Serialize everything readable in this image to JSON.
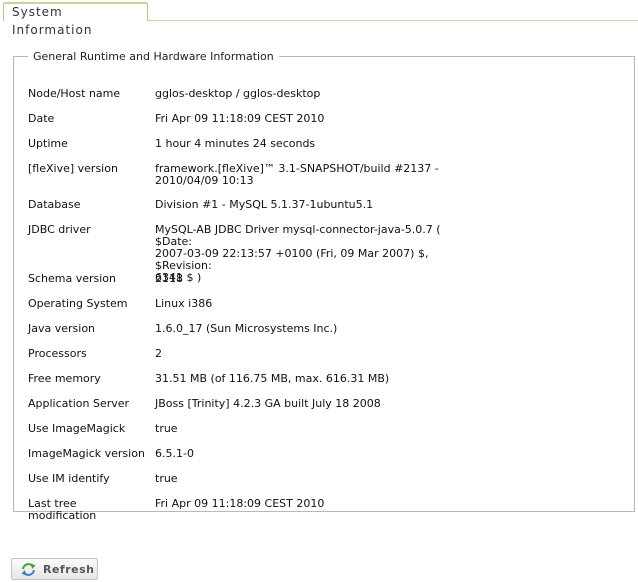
{
  "tab": {
    "label": "System Information"
  },
  "panel": {
    "legend": "General Runtime and Hardware Information",
    "rows": [
      {
        "label": "Node/Host name",
        "lines": [
          "gglos-desktop / gglos-desktop"
        ]
      },
      {
        "label": "Date",
        "lines": [
          "Fri Apr 09 11:18:09 CEST 2010"
        ]
      },
      {
        "label": "Uptime",
        "lines": [
          "1 hour 4 minutes 24 seconds"
        ]
      },
      {
        "label": "[fleXive] version",
        "lines": [
          "framework.[fleXive]™ 3.1-SNAPSHOT/build #2137 -",
          "2010/04/09 10:13"
        ]
      },
      {
        "label": "Database",
        "lines": [
          "Division #1 - MySQL 5.1.37-1ubuntu5.1"
        ]
      },
      {
        "label": "JDBC driver",
        "lines": [
          "MySQL-AB JDBC Driver mysql-connector-java-5.0.7 ( $Date:",
          "2007-03-09 22:13:57 +0100 (Fri, 09 Mar 2007) $, $Revision:",
          "6341 $ )"
        ]
      },
      {
        "label": "Schema version",
        "lines": [
          "2118"
        ]
      },
      {
        "label": "Operating System",
        "lines": [
          "Linux i386"
        ]
      },
      {
        "label": "Java version",
        "lines": [
          "1.6.0_17 (Sun Microsystems Inc.)"
        ]
      },
      {
        "label": "Processors",
        "lines": [
          "2"
        ]
      },
      {
        "label": "Free memory",
        "lines": [
          "31.51 MB (of 116.75 MB, max. 616.31 MB)"
        ]
      },
      {
        "label": "Application Server",
        "lines": [
          "JBoss [Trinity] 4.2.3 GA built July 18 2008"
        ]
      },
      {
        "label": "Use ImageMagick",
        "lines": [
          "true"
        ]
      },
      {
        "label": "ImageMagick version",
        "lines": [
          "6.5.1-0"
        ]
      },
      {
        "label": "Use IM identify",
        "lines": [
          "true"
        ]
      },
      {
        "label": "Last tree modification",
        "lines": [
          "Fri Apr 09 11:18:09 CEST 2010"
        ]
      }
    ]
  },
  "refresh_button": {
    "label": "Refresh",
    "icon": "refresh-icon"
  }
}
